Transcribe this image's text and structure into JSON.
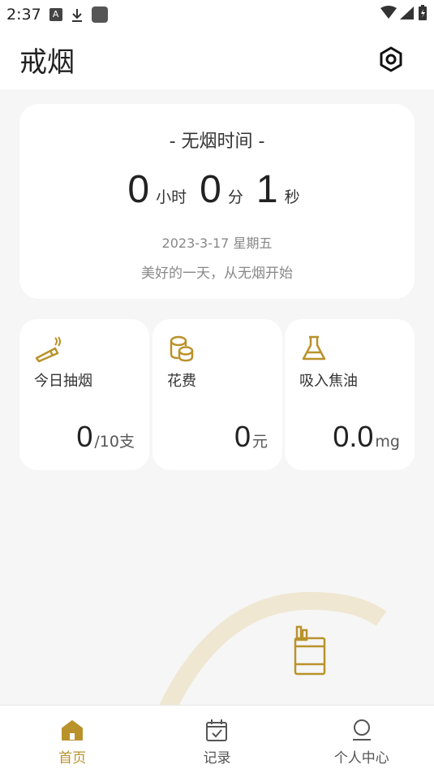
{
  "status_bar": {
    "time": "2:37",
    "a_badge": "A"
  },
  "header": {
    "title": "戒烟"
  },
  "timer": {
    "label": "- 无烟时间 -",
    "hours": "0",
    "hours_unit": "小时",
    "minutes": "0",
    "minutes_unit": "分",
    "seconds": "1",
    "seconds_unit": "秒",
    "date": "2023-3-17 星期五",
    "slogan": "美好的一天，从无烟开始"
  },
  "stats": [
    {
      "label": "今日抽烟",
      "value": "0",
      "unit": "/10支",
      "icon": "cigarette-icon"
    },
    {
      "label": "花费",
      "value": "0",
      "unit": "元",
      "icon": "coins-icon"
    },
    {
      "label": "吸入焦油",
      "value": "0.0",
      "unit": "mg",
      "icon": "flask-icon"
    }
  ],
  "nav": {
    "items": [
      {
        "label": "首页",
        "icon": "home-icon",
        "active": true
      },
      {
        "label": "记录",
        "icon": "calendar-check-icon",
        "active": false
      },
      {
        "label": "个人中心",
        "icon": "person-icon",
        "active": false
      }
    ]
  },
  "colors": {
    "accent": "#b9922b",
    "arc": "#efe7d2",
    "background": "#f6f6f6",
    "card": "#ffffff"
  }
}
